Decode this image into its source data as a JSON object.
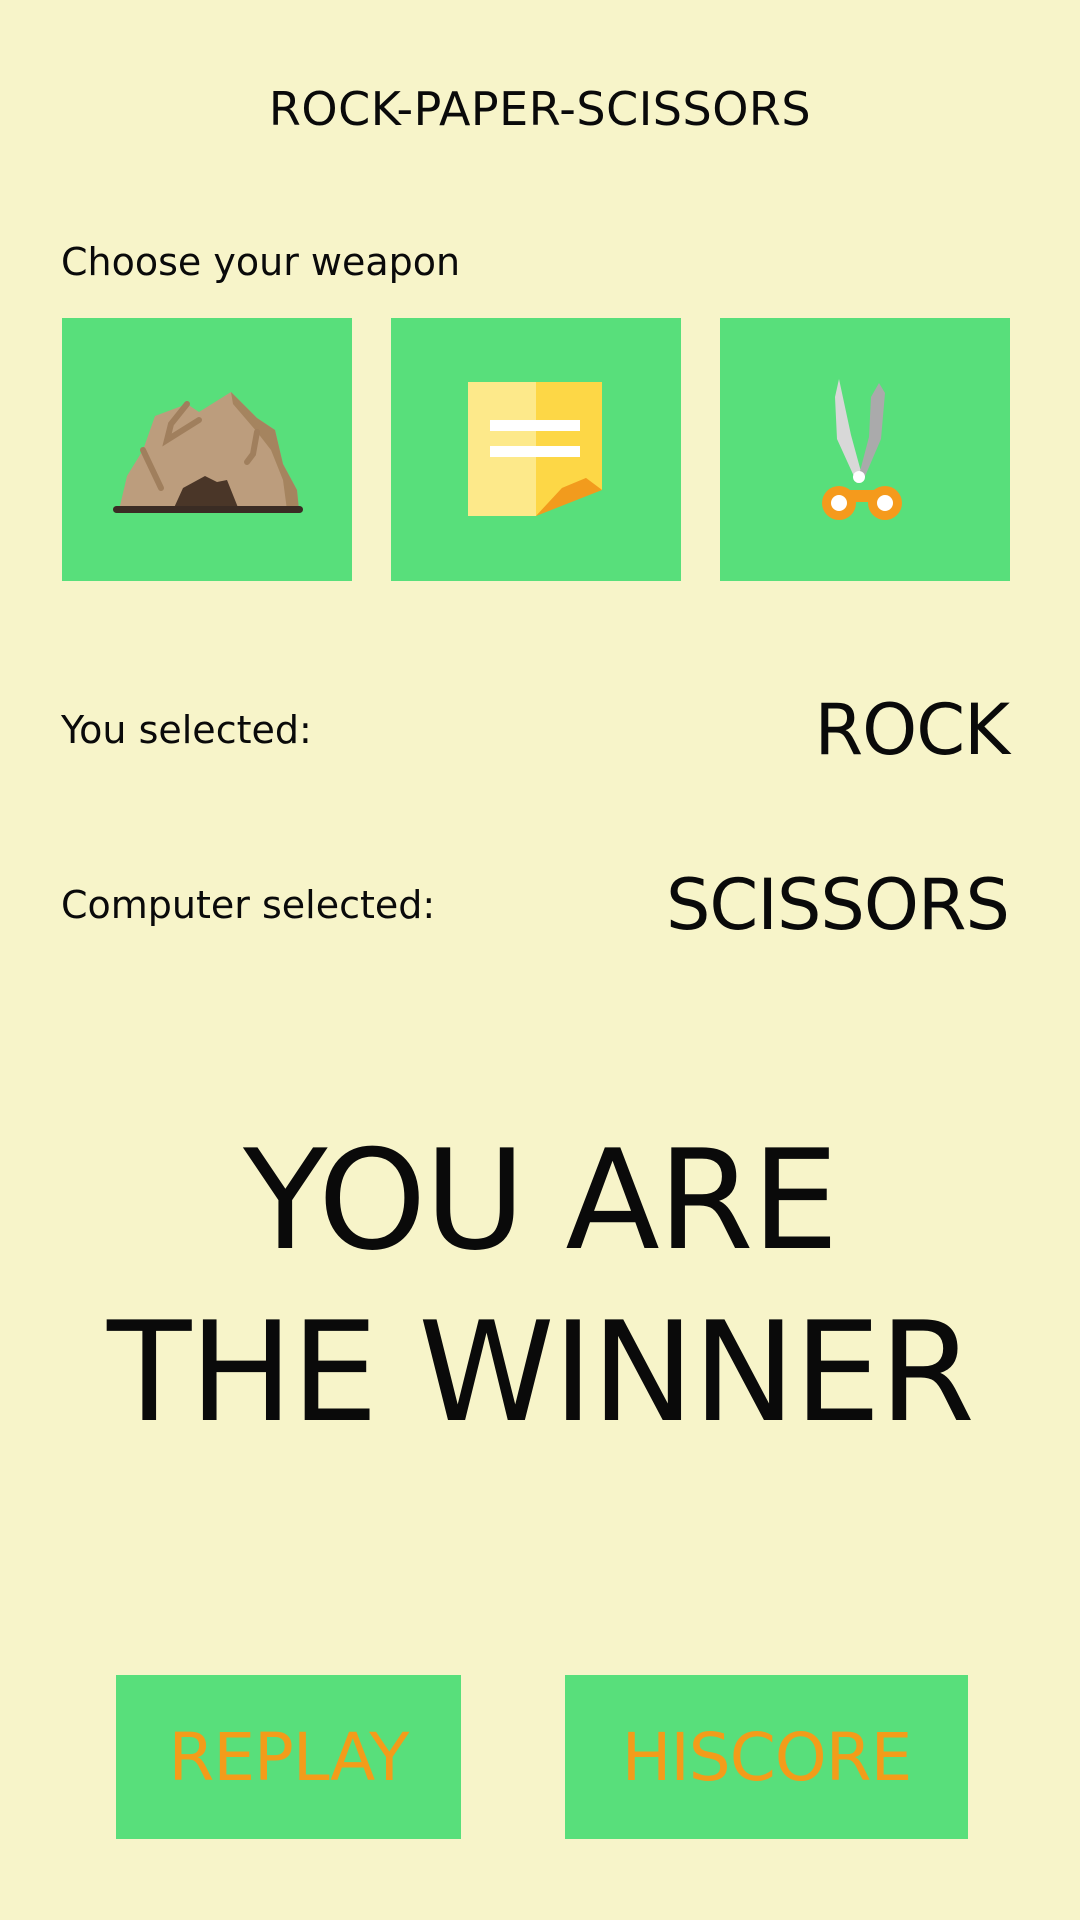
{
  "header": {
    "title": "ROCK-PAPER-SCISSORS"
  },
  "weapons": {
    "prompt": "Choose your weapon",
    "items": [
      {
        "id": "rock",
        "icon": "rock-cave-icon"
      },
      {
        "id": "paper",
        "icon": "paper-note-icon"
      },
      {
        "id": "scissors",
        "icon": "scissors-icon"
      }
    ]
  },
  "selection": {
    "you_label": "You selected:",
    "you_value": "ROCK",
    "computer_label": "Computer selected:",
    "computer_value": "SCISSORS"
  },
  "result": {
    "line1": "YOU ARE",
    "line2": "THE WINNER"
  },
  "actions": {
    "replay_label": "REPLAY",
    "hiscore_label": "HISCORE"
  },
  "colors": {
    "background": "#f7f4c9",
    "button": "#58df7b",
    "accent": "#f39c1a",
    "text": "#0a0a0a"
  }
}
